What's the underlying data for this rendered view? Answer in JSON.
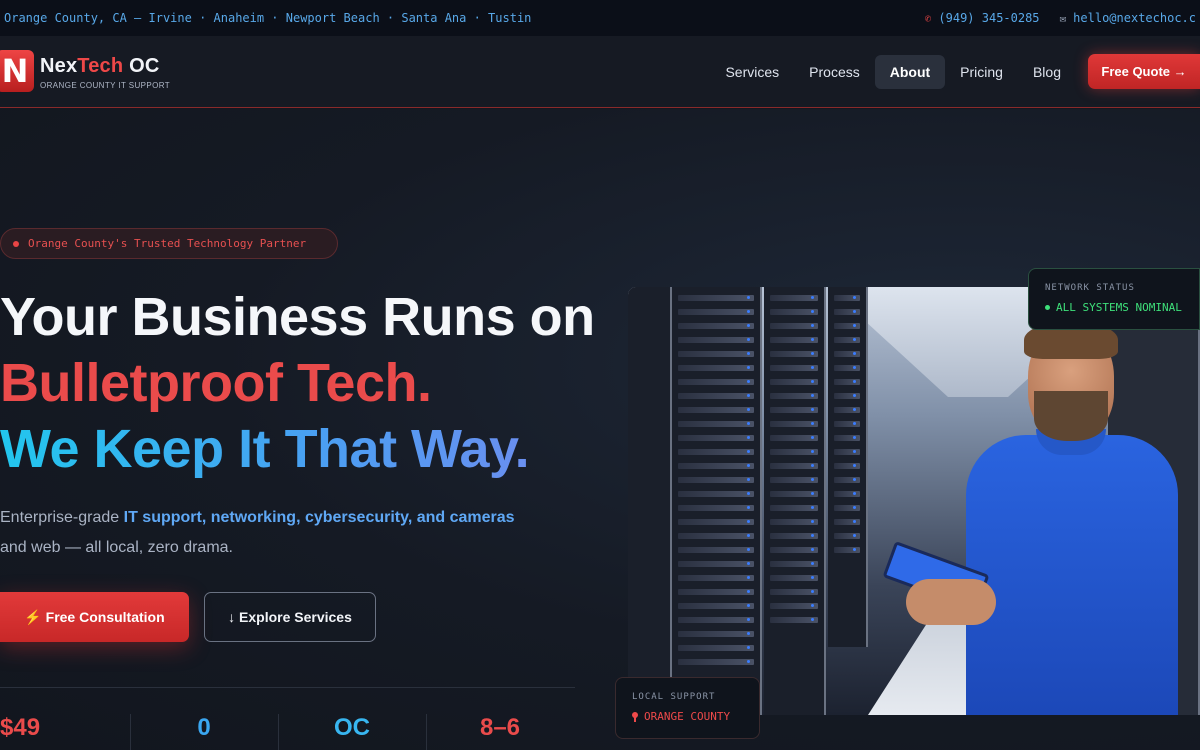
{
  "topbar": {
    "location": "Orange County, CA — Irvine · Anaheim · Newport Beach · Santa Ana · Tustin",
    "phone": "(949) 345-0285",
    "email": "hello@nextechoc.c"
  },
  "brand": {
    "mark": "N",
    "name_white": "Nex",
    "name_red": "Tech",
    "name_suffix": "OC",
    "tagline": "ORANGE COUNTY IT SUPPORT"
  },
  "nav": {
    "items": [
      {
        "label": "Services"
      },
      {
        "label": "Process"
      },
      {
        "label": "About"
      },
      {
        "label": "Pricing"
      },
      {
        "label": "Blog"
      }
    ],
    "active": "About",
    "cta": "Free Quote →"
  },
  "hero": {
    "pill": "Orange County's Trusted Technology Partner",
    "line1": "Your Business Runs on",
    "line2": "Bulletproof Tech.",
    "line3": "We Keep It That Way.",
    "lede_start": "Enterprise-grade ",
    "lede_hl": "IT support, networking, cybersecurity, and cameras",
    "lede_end": "and web — all local, zero drama.",
    "primary_cta": "⚡ Free Consultation",
    "secondary_cta": "↓ Explore Services"
  },
  "stats": [
    "$49",
    "0",
    "OC",
    "8–6"
  ],
  "badges": {
    "network_label": "NETWORK STATUS",
    "network_value": "ALL SYSTEMS NOMINAL",
    "local_label": "LOCAL SUPPORT",
    "local_value": "ORANGE COUNTY"
  },
  "colors": {
    "accent_red": "#e23a3a",
    "accent_blue": "#3aa6f0",
    "status_green": "#3ee07a",
    "background": "#131720"
  }
}
